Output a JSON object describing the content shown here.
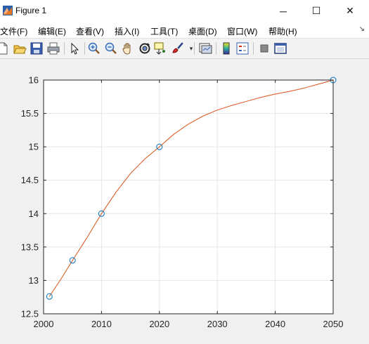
{
  "window": {
    "title": "Figure 1",
    "minimize_glyph": "─",
    "maximize_glyph": "☐",
    "close_glyph": "✕"
  },
  "menu": {
    "items": [
      "文件(F)",
      "编辑(E)",
      "查看(V)",
      "插入(I)",
      "工具(T)",
      "桌面(D)",
      "窗口(W)",
      "帮助(H)"
    ],
    "more_glyph": "↘"
  },
  "toolbar": {
    "icons": [
      "new-figure-icon",
      "open-file-icon",
      "save-icon",
      "print-icon",
      "select-arrow-icon",
      "zoom-in-icon",
      "zoom-out-icon",
      "pan-hand-icon",
      "rotate-3d-icon",
      "data-cursor-icon",
      "brush-icon",
      "link-plot-icon",
      "colorbar-icon",
      "legend-icon",
      "hide-plot-tools-icon",
      "show-plot-tools-icon"
    ]
  },
  "colors": {
    "line": "#d95319",
    "markers": "#0072bd",
    "grid": "#e6e6e6",
    "axes": "#262626"
  },
  "chart_data": {
    "type": "line",
    "title": "",
    "xlabel": "",
    "ylabel": "",
    "xlim": [
      2000,
      2050
    ],
    "ylim": [
      12.5,
      16
    ],
    "xticks": [
      2000,
      2010,
      2020,
      2030,
      2040,
      2050
    ],
    "yticks": [
      12.5,
      13,
      13.5,
      14,
      14.5,
      15,
      15.5,
      16
    ],
    "xtick_labels": [
      "2000",
      "2010",
      "2020",
      "2030",
      "2040",
      "2050"
    ],
    "ytick_labels": [
      "12.5",
      "13",
      "13.5",
      "14",
      "14.5",
      "15",
      "15.5",
      "16"
    ],
    "grid": true,
    "series": [
      {
        "style": "markers",
        "marker": "circle",
        "x": [
          2001,
          2005,
          2010,
          2020,
          2050
        ],
        "y": [
          12.76,
          13.3,
          14.0,
          15.0,
          16.0
        ]
      },
      {
        "style": "line",
        "x": [
          2001,
          2003,
          2005,
          2007.5,
          2010,
          2012.5,
          2015,
          2017.5,
          2020,
          2022.5,
          2025,
          2027.5,
          2030,
          2032.5,
          2035,
          2037.5,
          2040,
          2042.5,
          2045,
          2047.5,
          2050
        ],
        "y": [
          12.76,
          13.02,
          13.3,
          13.64,
          14.0,
          14.32,
          14.6,
          14.82,
          15.0,
          15.19,
          15.34,
          15.46,
          15.55,
          15.62,
          15.68,
          15.74,
          15.79,
          15.83,
          15.88,
          15.94,
          16.0
        ]
      }
    ]
  }
}
